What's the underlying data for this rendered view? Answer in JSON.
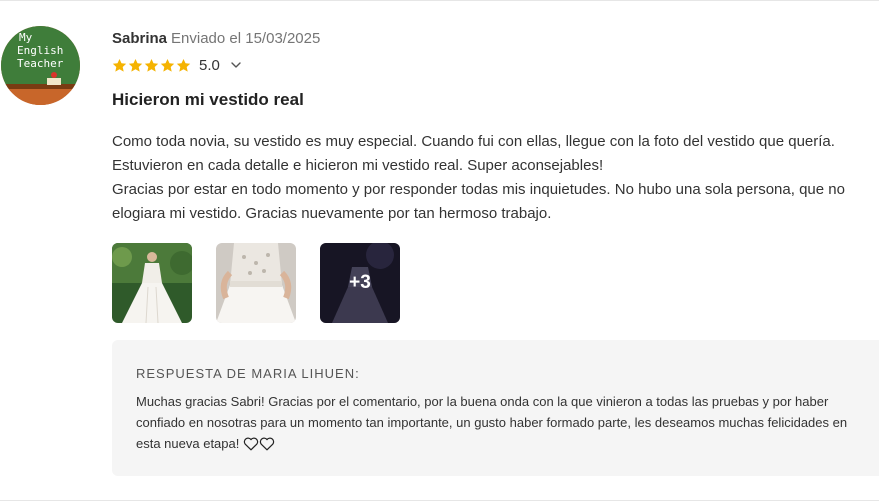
{
  "review": {
    "reviewer_name": "Sabrina",
    "sent_label": "Enviado el 15/03/2025",
    "rating_value": "5.0",
    "stars": 5,
    "title": "Hicieron mi vestido real",
    "body": [
      "Como toda novia, su vestido es muy especial. Cuando fui con ellas, llegue con la foto del vestido que quería. Estuvieron en cada detalle e hicieron mi vestido real. Super aconsejables!",
      "Gracias por estar en todo momento y por responder todas mis inquietudes. No hubo una sola persona, que no elogiara mi vestido. Gracias nuevamente por tan hermoso trabajo."
    ],
    "more_photos_label": "+3"
  },
  "avatar": {
    "lines": [
      "My",
      "English",
      "Teacher"
    ]
  },
  "reply": {
    "heading": "RESPUESTA DE MARIA LIHUEN:",
    "text": "Muchas gracias Sabri! Gracias por el comentario, por la buena onda con la que vinieron a todas las pruebas y por haber confiado en nosotras para un momento tan importante, un gusto haber formado parte, les deseamos muchas felicidades en esta nueva etapa!"
  },
  "colors": {
    "star": "#f5b301",
    "reply_background": "#f5f5f5",
    "chalkboard": "#2e7d32"
  },
  "icons": [
    "star-icon",
    "chevron-down-icon",
    "heart-outline-icon"
  ]
}
